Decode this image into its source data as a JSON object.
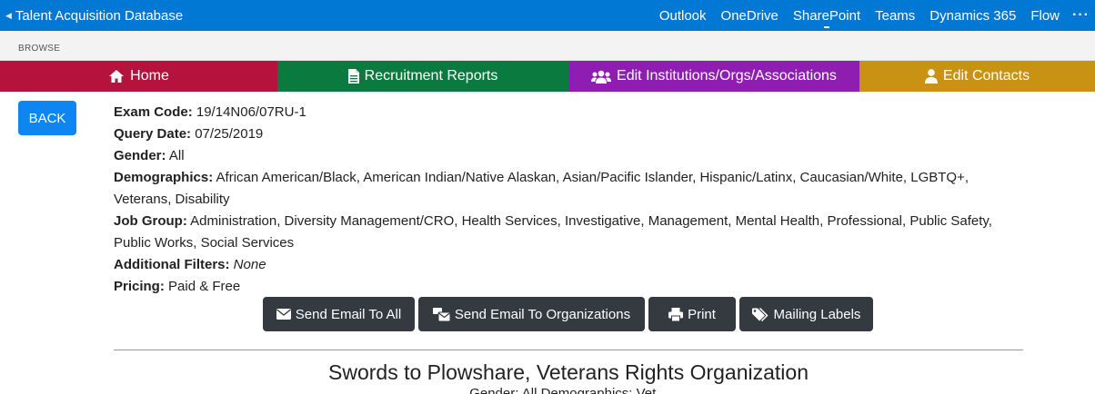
{
  "suite": {
    "app_title": "Talent Acquisition Database",
    "links": [
      {
        "label": "Outlook"
      },
      {
        "label": "OneDrive"
      },
      {
        "label": "SharePoint"
      },
      {
        "label": "Teams"
      },
      {
        "label": "Dynamics 365"
      },
      {
        "label": "Flow"
      }
    ],
    "more": "···"
  },
  "ribbon": {
    "browse": "BROWSE"
  },
  "nav": {
    "home": "Home",
    "reports": "Recruitment Reports",
    "institutions": "Edit Institutions/Orgs/Associations",
    "contacts": "Edit Contacts"
  },
  "back_label": "BACK",
  "details": {
    "exam_code_label": "Exam Code:",
    "exam_code": "19/14N06/07RU-1",
    "query_date_label": "Query Date:",
    "query_date": "07/25/2019",
    "gender_label": "Gender:",
    "gender": "All",
    "demographics_label": "Demographics:",
    "demographics": "African American/Black, American Indian/Native Alaskan, Asian/Pacific Islander, Hispanic/Latinx, Caucasian/White, LGBTQ+, Veterans, Disability",
    "job_group_label": "Job Group:",
    "job_group": "Administration, Diversity Management/CRO, Health Services, Investigative, Management, Mental Health, Professional, Public Safety, Public Works, Social Services",
    "additional_filters_label": "Additional Filters:",
    "additional_filters": "None",
    "pricing_label": "Pricing:",
    "pricing": "Paid & Free"
  },
  "actions": {
    "email_all": "Send Email To All",
    "email_orgs": "Send Email To Organizations",
    "print": "Print",
    "mailing_labels": "Mailing Labels"
  },
  "organization": {
    "name": "Swords to Plowshare, Veterans Rights Organization",
    "subline": "Gender: All  Demographics: Vet..."
  },
  "colors": {
    "suite_bar": "#0078d4",
    "home": "#b5123e",
    "reports": "#0a7a3f",
    "institutions": "#8f1db2",
    "contacts": "#c99212",
    "back": "#0d86f2",
    "action": "#343a40"
  }
}
